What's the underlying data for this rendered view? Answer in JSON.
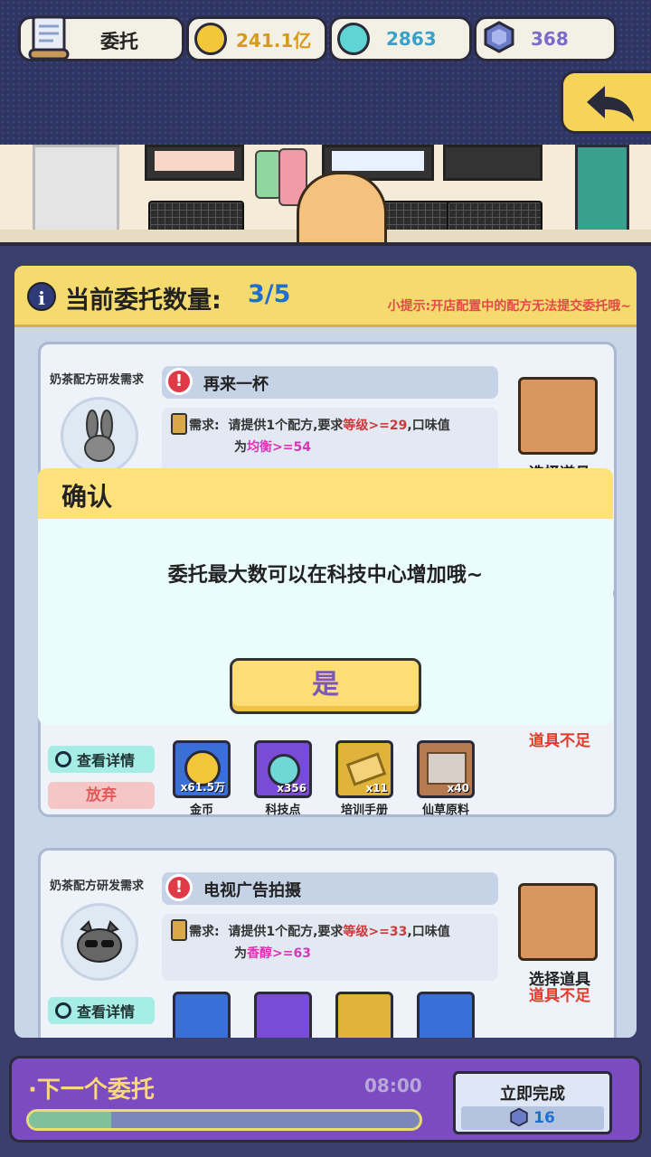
{
  "topbar": {
    "title": "委托",
    "gold": "241.1亿",
    "tech": "2863",
    "gem": "368"
  },
  "panel": {
    "title": "当前委托数量:",
    "count": "3/5",
    "tip": "小提示:开店配置中的配方无法提交委托哦~"
  },
  "cards": [
    {
      "type": "奶茶配方研发需求",
      "title": "再来一杯",
      "req_prefix": "需求:",
      "req_line1": "请提供1个配方,要求",
      "req_level_word": "等级",
      "req_level_val": ">=29",
      "req_mid": ",口味值",
      "req_line2_prefix": "为",
      "req_taste": "均衡",
      "req_taste_val": ">=54",
      "select_label": "选择道具"
    },
    {
      "insufficient": "道具不足",
      "view": "查看详情",
      "give_up": "放弃",
      "rewards": [
        {
          "name": "金币",
          "count": "x61.5万",
          "icon": "gold-coin"
        },
        {
          "name": "科技点",
          "count": "x356",
          "icon": "tech-flask"
        },
        {
          "name": "培训手册",
          "count": "x11",
          "icon": "book"
        },
        {
          "name": "仙草原料",
          "count": "x40",
          "icon": "herb-box"
        }
      ]
    },
    {
      "type": "奶茶配方研发需求",
      "title": "电视广告拍摄",
      "req_prefix": "需求:",
      "req_line1": "请提供1个配方,要求",
      "req_level_word": "等级",
      "req_level_val": ">=33",
      "req_mid": ",口味值",
      "req_line2_prefix": "为",
      "req_taste": "香醇",
      "req_taste_val": ">=63",
      "select_label": "选择道具",
      "insufficient": "道具不足",
      "view": "查看详情"
    }
  ],
  "dialog": {
    "title": "确认",
    "message": "委托最大数可以在科技中心增加哦~",
    "confirm": "是"
  },
  "next": {
    "label": "·下一个委托",
    "time": "08:00",
    "progress": 0.21,
    "finish_label": "立即完成",
    "finish_cost": "16"
  },
  "colors": {
    "accent_yellow": "#f5da6e",
    "tech_blue": "#1f6fd0",
    "warn_red": "#e23a2a",
    "purple": "#7b4bc2"
  }
}
